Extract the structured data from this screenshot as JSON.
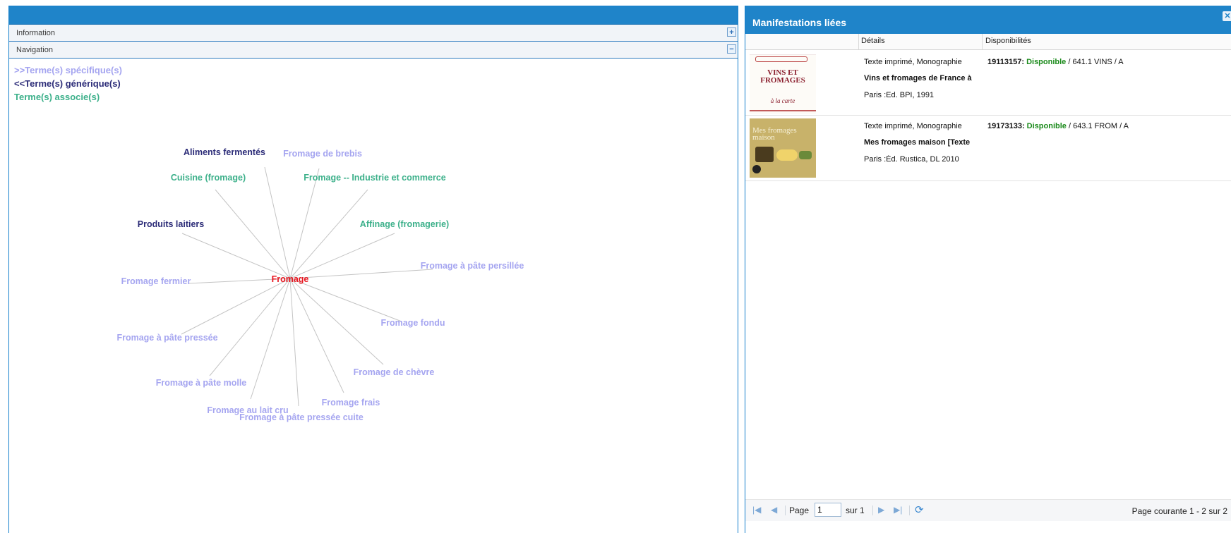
{
  "left_panel": {
    "accordion": {
      "information": "Information",
      "navigation": "Navigation",
      "expand_symbol": "+",
      "collapse_symbol": "−"
    },
    "legend": {
      "specific": ">>Terme(s) spécifique(s)",
      "generic": "<<Terme(s) générique(s)",
      "associated": "Terme(s) associe(s)"
    },
    "colors": {
      "specific": "#a5a5f0",
      "generic": "#2c2c78",
      "associated": "#3cb08a",
      "center": "#e8141e"
    },
    "graph": {
      "center": "Fromage",
      "nodes": [
        {
          "label": "Aliments fermentés",
          "type": "generic"
        },
        {
          "label": "Fromage de brebis",
          "type": "specific"
        },
        {
          "label": "Cuisine (fromage)",
          "type": "associated"
        },
        {
          "label": "Fromage -- Industrie et commerce",
          "type": "associated"
        },
        {
          "label": "Produits laitiers",
          "type": "generic"
        },
        {
          "label": "Affinage (fromagerie)",
          "type": "associated"
        },
        {
          "label": "Fromage à pâte persillée",
          "type": "specific"
        },
        {
          "label": "Fromage fermier",
          "type": "specific"
        },
        {
          "label": "Fromage fondu",
          "type": "specific"
        },
        {
          "label": "Fromage à pâte pressée",
          "type": "specific"
        },
        {
          "label": "Fromage de chèvre",
          "type": "specific"
        },
        {
          "label": "Fromage à pâte molle",
          "type": "specific"
        },
        {
          "label": "Fromage frais",
          "type": "specific"
        },
        {
          "label": "Fromage au lait cru",
          "type": "specific"
        },
        {
          "label": "Fromage à pâte pressée cuite",
          "type": "specific"
        }
      ]
    }
  },
  "right_panel": {
    "title": "Manifestations liées",
    "close_symbol": "✕",
    "columns": {
      "details": "Détails",
      "availability": "Disponibilités"
    },
    "rows": [
      {
        "type": "Texte imprimé, Monographie",
        "title": "Vins et fromages de France à",
        "publisher": "Paris :Ed. BPI, 1991",
        "code": "19113157:",
        "status": "Disponible",
        "shelf": " / 641.1 VINS / A",
        "cover_text": [
          "VINS ET",
          "FROMAGES",
          "à la carte"
        ]
      },
      {
        "type": "Texte imprimé, Monographie",
        "title": "Mes fromages maison [Texte",
        "publisher": "Paris :Éd. Rustica, DL 2010",
        "code": "19173133:",
        "status": "Disponible",
        "shelf": " / 643.1 FROM / A",
        "cover_text": [
          "Mes fromages",
          "maison"
        ]
      }
    ],
    "pager": {
      "page_label": "Page",
      "page_value": "1",
      "of_label": "sur 1",
      "status": "Page courante 1 - 2 sur 2"
    }
  }
}
